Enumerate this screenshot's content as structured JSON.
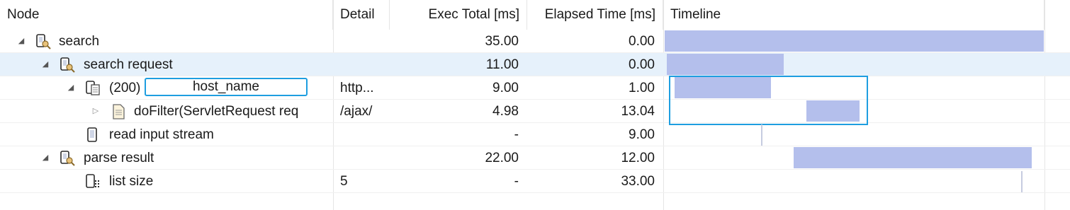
{
  "columns": {
    "node": "Node",
    "detail": "Detail",
    "exec_total": "Exec Total [ms]",
    "elapsed": "Elapsed Time [ms]",
    "timeline": "Timeline"
  },
  "rows": [
    {
      "node": "search",
      "detail": "",
      "exec_total": "35.00",
      "elapsed": "0.00",
      "expanded": true
    },
    {
      "node": "search request",
      "detail": "",
      "exec_total": "11.00",
      "elapsed": "0.00",
      "expanded": true,
      "selected": true
    },
    {
      "node_prefix": "(200)",
      "node": "host_name",
      "detail": "http...",
      "exec_total": "9.00",
      "elapsed": "1.00",
      "expanded": true
    },
    {
      "node": "doFilter(ServletRequest req",
      "detail": "/ajax/",
      "exec_total": "4.98",
      "elapsed": "13.04",
      "expanded": false
    },
    {
      "node": "read input stream",
      "detail": "",
      "exec_total": "-",
      "elapsed": "9.00"
    },
    {
      "node": "parse result",
      "detail": "",
      "exec_total": "22.00",
      "elapsed": "12.00",
      "expanded": true
    },
    {
      "node": "list size",
      "detail": "5",
      "exec_total": "-",
      "elapsed": "33.00"
    }
  ],
  "icons": {
    "search": "search-request-icon",
    "request": "http-request-icon",
    "filter": "document-icon",
    "stream": "device-icon",
    "value": "value-icon"
  },
  "colors": {
    "timeline_bar": "#b4bfec",
    "selection": "#e6f1fb",
    "highlight": "#1e9ee0"
  }
}
